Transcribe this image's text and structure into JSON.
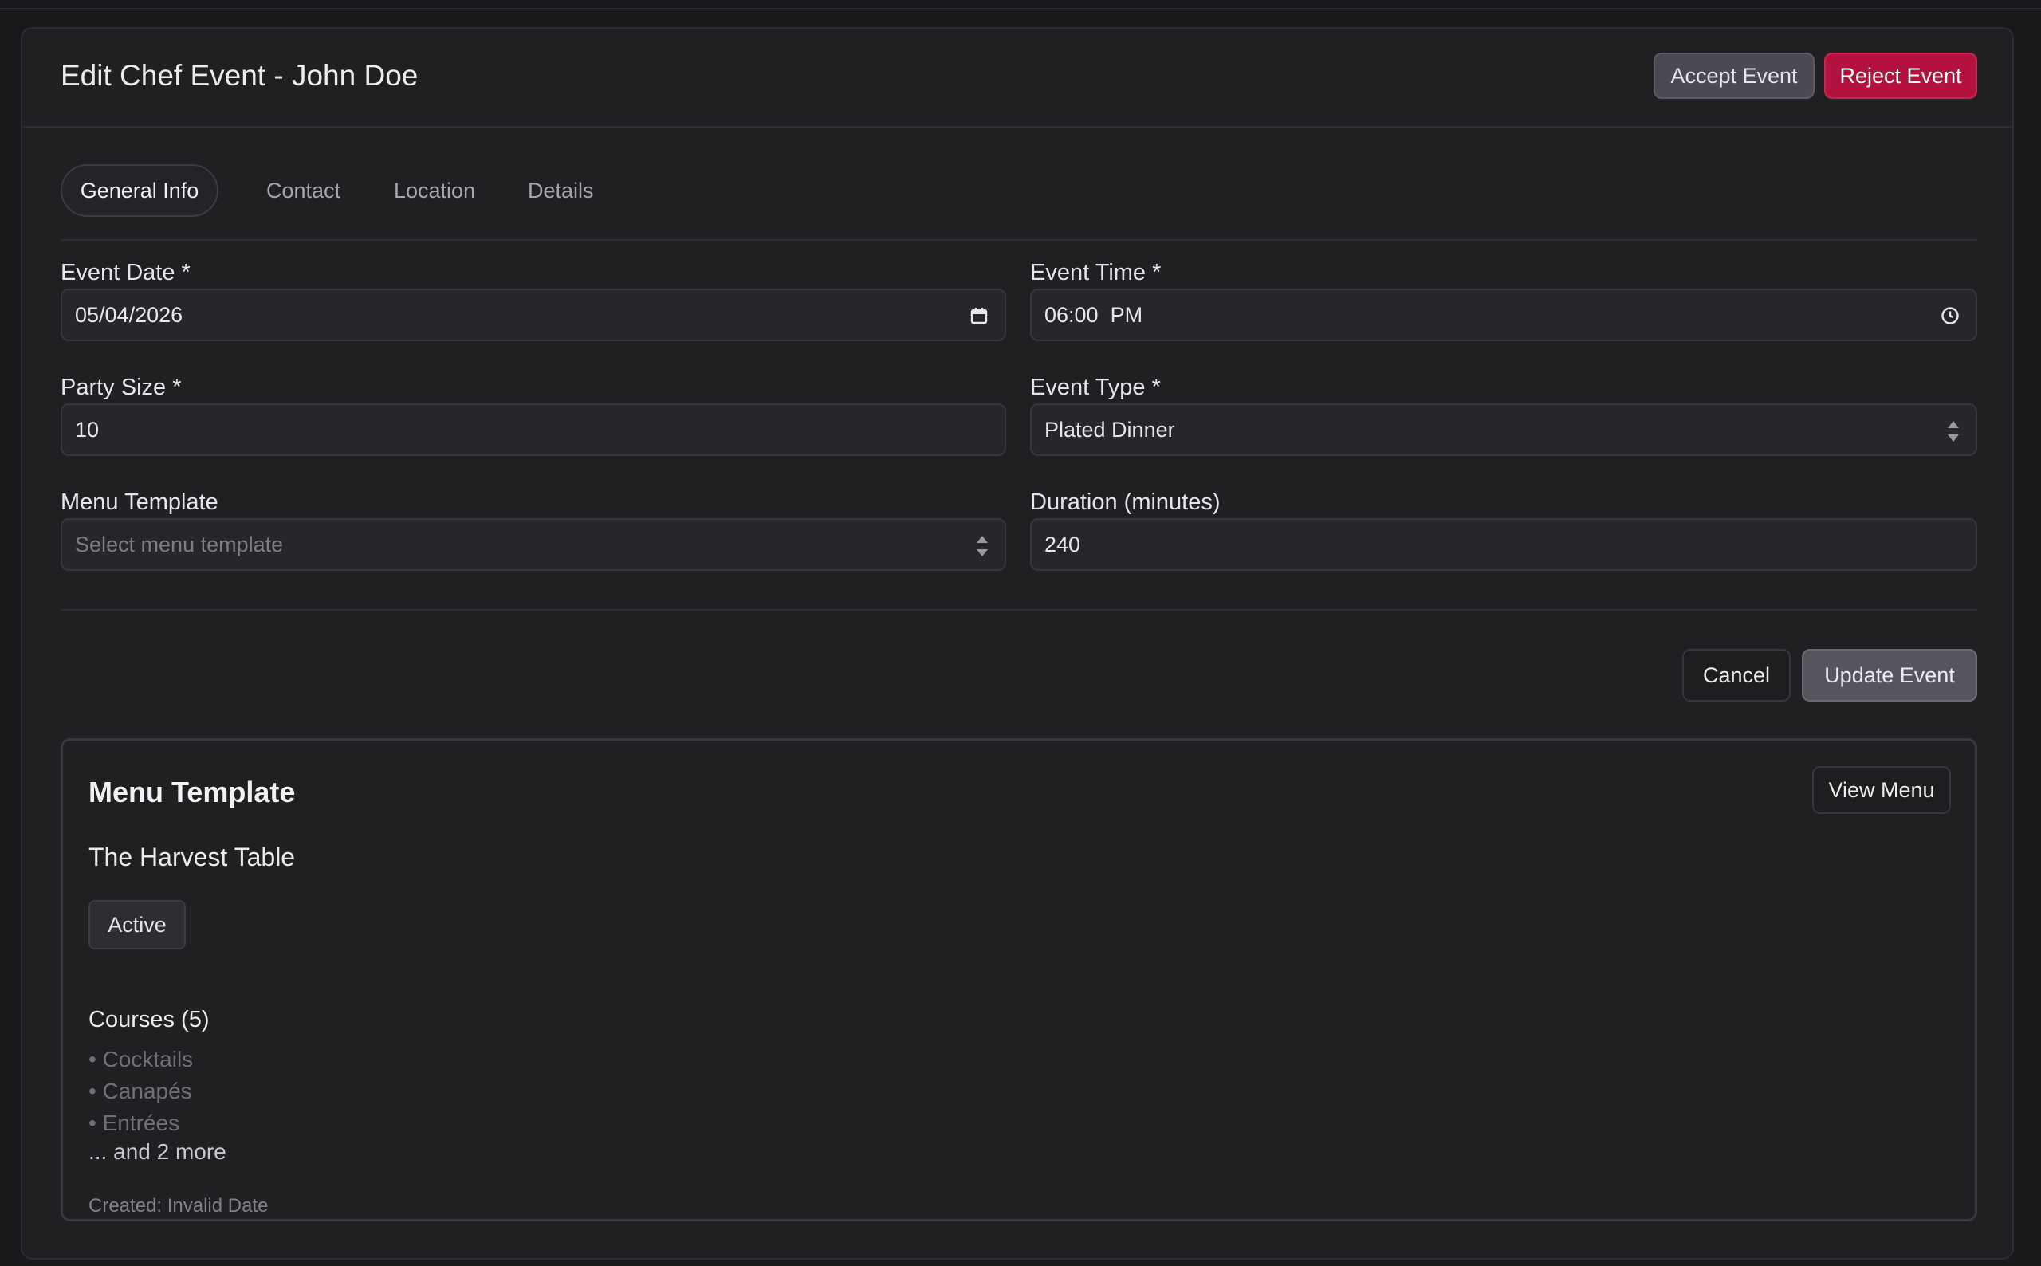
{
  "header": {
    "title": "Edit Chef Event - John Doe",
    "accept_label": "Accept Event",
    "reject_label": "Reject Event"
  },
  "tabs": [
    {
      "label": "General Info",
      "active": true
    },
    {
      "label": "Contact",
      "active": false
    },
    {
      "label": "Location",
      "active": false
    },
    {
      "label": "Details",
      "active": false
    }
  ],
  "form": {
    "event_date": {
      "label": "Event Date *",
      "value": "05/04/2026",
      "icon": "calendar-icon"
    },
    "event_time": {
      "label": "Event Time *",
      "value": "06:00  PM",
      "icon": "clock-icon"
    },
    "party_size": {
      "label": "Party Size *",
      "value": "10"
    },
    "event_type": {
      "label": "Event Type *",
      "value": "Plated Dinner"
    },
    "menu_template": {
      "label": "Menu Template",
      "placeholder": "Select menu template"
    },
    "duration": {
      "label": "Duration (minutes)",
      "value": "240"
    }
  },
  "actions": {
    "cancel_label": "Cancel",
    "update_label": "Update Event"
  },
  "menu_card": {
    "title": "Menu Template",
    "view_label": "View Menu",
    "name": "The Harvest Table",
    "status": "Active",
    "courses_title": "Courses (5)",
    "courses": [
      "• Cocktails",
      "• Canapés",
      "• Entrées"
    ],
    "more_text": "... and 2 more",
    "created_text": "Created: Invalid Date"
  },
  "colors": {
    "background": "#19191b",
    "card": "#202023",
    "reject": "#b3123e",
    "accept": "#4a4a52"
  }
}
